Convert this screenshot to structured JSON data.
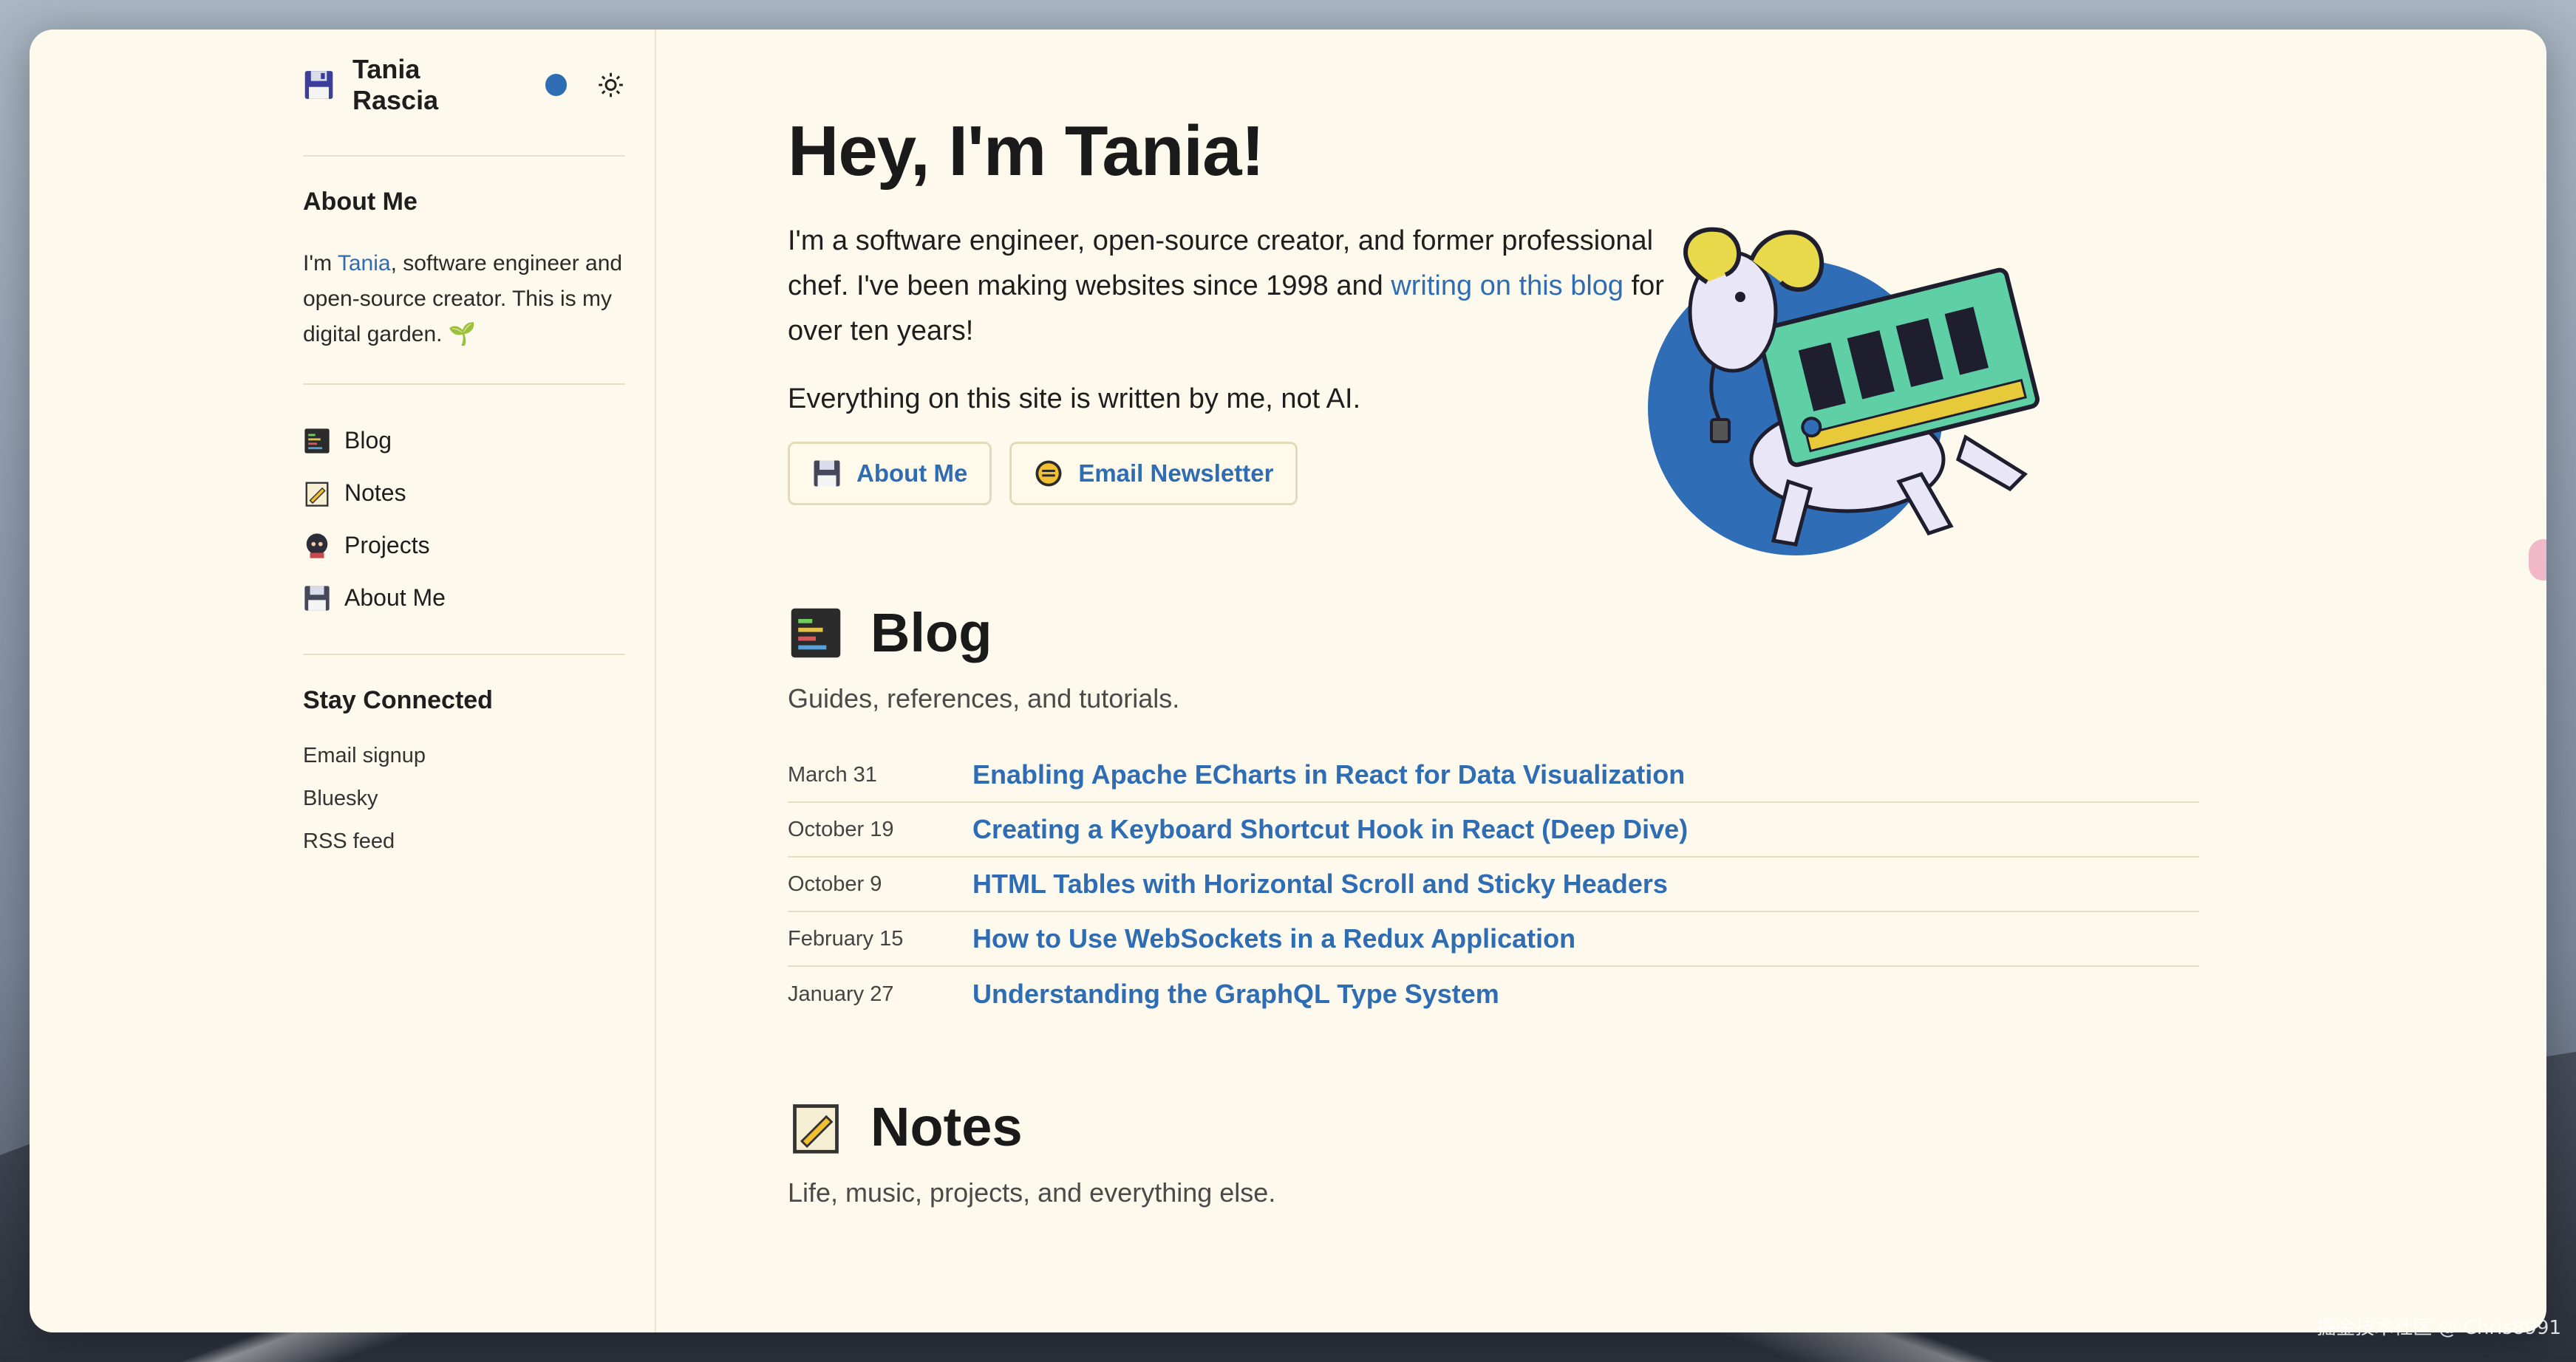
{
  "sidebar": {
    "brand_name": "Tania Rascia",
    "about": {
      "heading": "About Me",
      "text_pre": "I'm ",
      "text_link": "Tania",
      "text_post": ", software engineer and open-source creator. This is my digital garden. 🌱"
    },
    "nav": [
      {
        "label": "Blog",
        "icon": "terminal-icon"
      },
      {
        "label": "Notes",
        "icon": "notepad-icon"
      },
      {
        "label": "Projects",
        "icon": "octocat-icon"
      },
      {
        "label": "About Me",
        "icon": "floppy-icon"
      }
    ],
    "connect": {
      "heading": "Stay Connected",
      "links": [
        "Email signup",
        "Bluesky",
        "RSS feed"
      ]
    }
  },
  "hero": {
    "title": "Hey, I'm Tania!",
    "p1_pre": "I'm a software engineer, open-source creator, and former professional chef. I've been making websites since 1998 and ",
    "p1_link": "writing on this blog",
    "p1_post": " for over ten years!",
    "p2": "Everything on this site is written by me, not AI.",
    "btn_about": "About Me",
    "btn_newsletter": "Email Newsletter"
  },
  "blog": {
    "title": "Blog",
    "subtitle": "Guides, references, and tutorials.",
    "posts": [
      {
        "date": "March 31",
        "title": "Enabling Apache ECharts in React for Data Visualization"
      },
      {
        "date": "October 19",
        "title": "Creating a Keyboard Shortcut Hook in React (Deep Dive)"
      },
      {
        "date": "October 9",
        "title": "HTML Tables with Horizontal Scroll and Sticky Headers"
      },
      {
        "date": "February 15",
        "title": "How to Use WebSockets in a Redux Application"
      },
      {
        "date": "January 27",
        "title": "Understanding the GraphQL Type System"
      }
    ]
  },
  "notes": {
    "title": "Notes",
    "subtitle": "Life, music, projects, and everything else."
  },
  "watermark": "掘金技术社区 @ Chris8991",
  "colors": {
    "accent": "#2e6db4",
    "background": "#fdf9ec"
  }
}
